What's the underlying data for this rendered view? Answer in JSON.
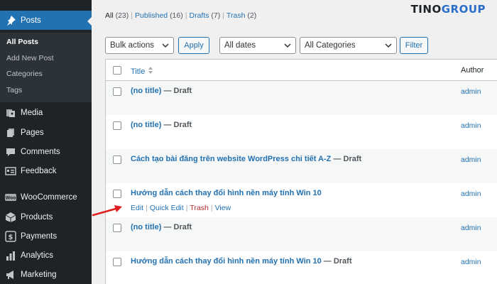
{
  "sidebar": {
    "posts_label": "Posts",
    "submenu": [
      "All Posts",
      "Add New Post",
      "Categories",
      "Tags"
    ],
    "items": [
      "Media",
      "Pages",
      "Comments",
      "Feedback",
      "WooCommerce",
      "Products",
      "Payments",
      "Analytics",
      "Marketing"
    ]
  },
  "views": {
    "all": "All",
    "all_count": "(23)",
    "published": "Published",
    "published_count": "(16)",
    "drafts": "Drafts",
    "drafts_count": "(7)",
    "trash": "Trash",
    "trash_count": "(2)",
    "sep": "|"
  },
  "logo": {
    "part1": "TINO",
    "part2": "GROUP"
  },
  "filters": {
    "bulk": "Bulk actions",
    "apply": "Apply",
    "dates": "All dates",
    "categories": "All Categories",
    "filter": "Filter"
  },
  "table": {
    "col_title": "Title",
    "col_author": "Author",
    "rows": [
      {
        "title": "(no title)",
        "state": "— Draft",
        "author": "admin"
      },
      {
        "title": "(no title)",
        "state": "— Draft",
        "author": "admin"
      },
      {
        "title": "Cách tạo bài đăng trên website WordPress chi tiết A-Z",
        "state": "— Draft",
        "author": "admin"
      },
      {
        "title": "Hướng dẫn cách thay đổi hình nền máy tính Win 10",
        "state": "",
        "author": "admin"
      },
      {
        "title": "(no title)",
        "state": "— Draft",
        "author": "admin"
      },
      {
        "title": "Hướng dẫn cách thay đổi hình nền máy tính Win 10",
        "state": "— Draft",
        "author": "admin"
      }
    ],
    "row_actions": {
      "edit": "Edit",
      "quick_edit": "Quick Edit",
      "trash": "Trash",
      "view": "View",
      "bar": "|"
    }
  },
  "colors": {
    "admin_bar": "#1d2327",
    "accent": "#2271b1",
    "arrow": "#e02020",
    "trash": "#b32d2e"
  }
}
